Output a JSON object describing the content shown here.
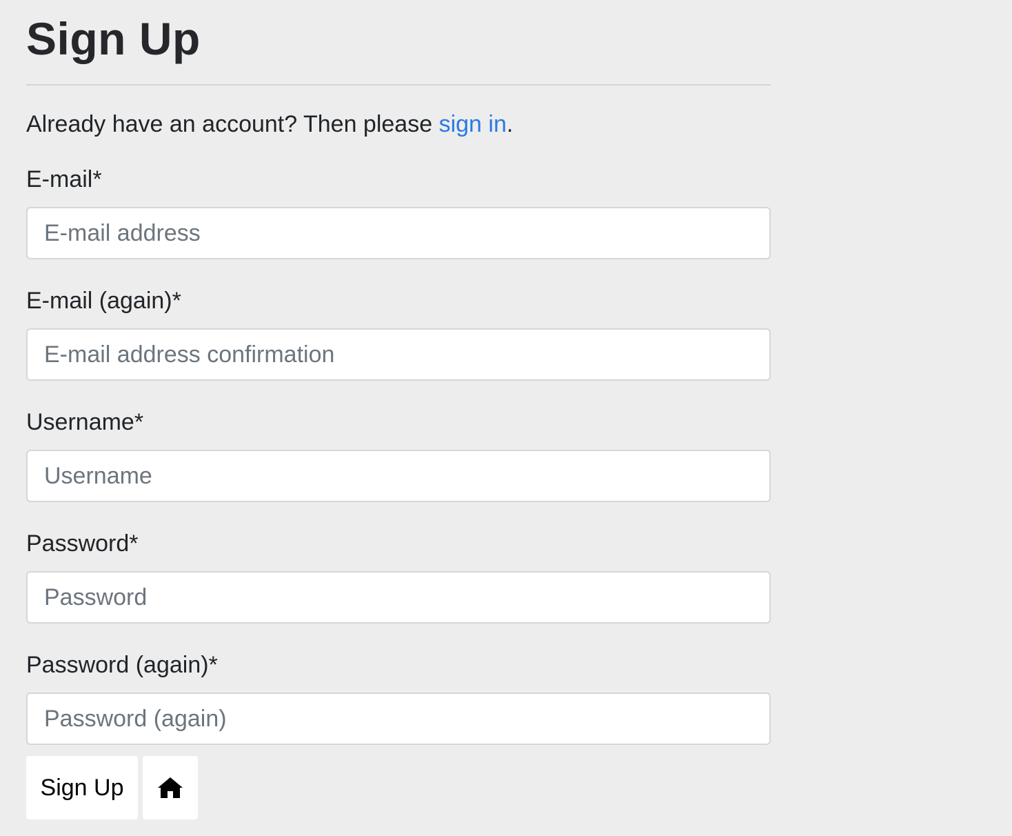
{
  "page": {
    "title": "Sign Up"
  },
  "intro": {
    "text": "Already have an account? Then please ",
    "link_text": "sign in",
    "suffix": "."
  },
  "form": {
    "fields": [
      {
        "label": "E-mail*",
        "placeholder": "E-mail address",
        "value": ""
      },
      {
        "label": "E-mail (again)*",
        "placeholder": "E-mail address confirmation",
        "value": ""
      },
      {
        "label": "Username*",
        "placeholder": "Username",
        "value": ""
      },
      {
        "label": "Password*",
        "placeholder": "Password",
        "value": ""
      },
      {
        "label": "Password (again)*",
        "placeholder": "Password (again)",
        "value": ""
      }
    ]
  },
  "actions": {
    "signup_label": "Sign Up",
    "home_icon": "home-icon"
  },
  "colors": {
    "background": "#ededed",
    "link": "#2a7ae2",
    "text": "#212529",
    "placeholder": "#6c757d"
  }
}
